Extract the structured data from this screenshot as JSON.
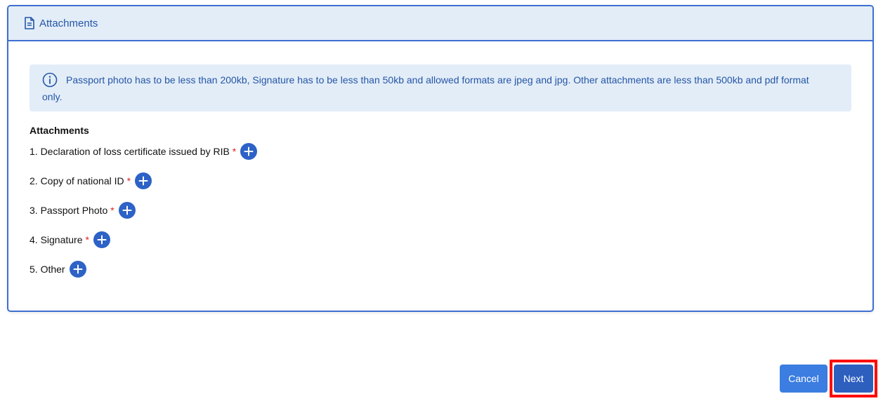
{
  "card": {
    "header_icon": "document-icon",
    "title": "Attachments",
    "info": {
      "icon": "info-circle-icon",
      "text": "Passport photo has to be less than 200kb, Signature has to be less than 50kb and allowed formats are jpeg and jpg. Other attachments are less than 500kb and pdf format only."
    },
    "section_title": "Attachments",
    "required_marker": "*",
    "attachments": [
      {
        "label": "1. Declaration of loss certificate issued by RIB",
        "required": true
      },
      {
        "label": "2. Copy of national ID",
        "required": true
      },
      {
        "label": "3. Passport Photo",
        "required": true
      },
      {
        "label": "4. Signature",
        "required": true
      },
      {
        "label": "5. Other",
        "required": false
      }
    ],
    "add_icon": "plus-icon"
  },
  "actions": {
    "cancel_label": "Cancel",
    "next_label": "Next"
  },
  "colors": {
    "accent": "#2d62c6",
    "header_bg": "#e3edf8",
    "required": "#e02424",
    "highlight": "#ff0000"
  }
}
